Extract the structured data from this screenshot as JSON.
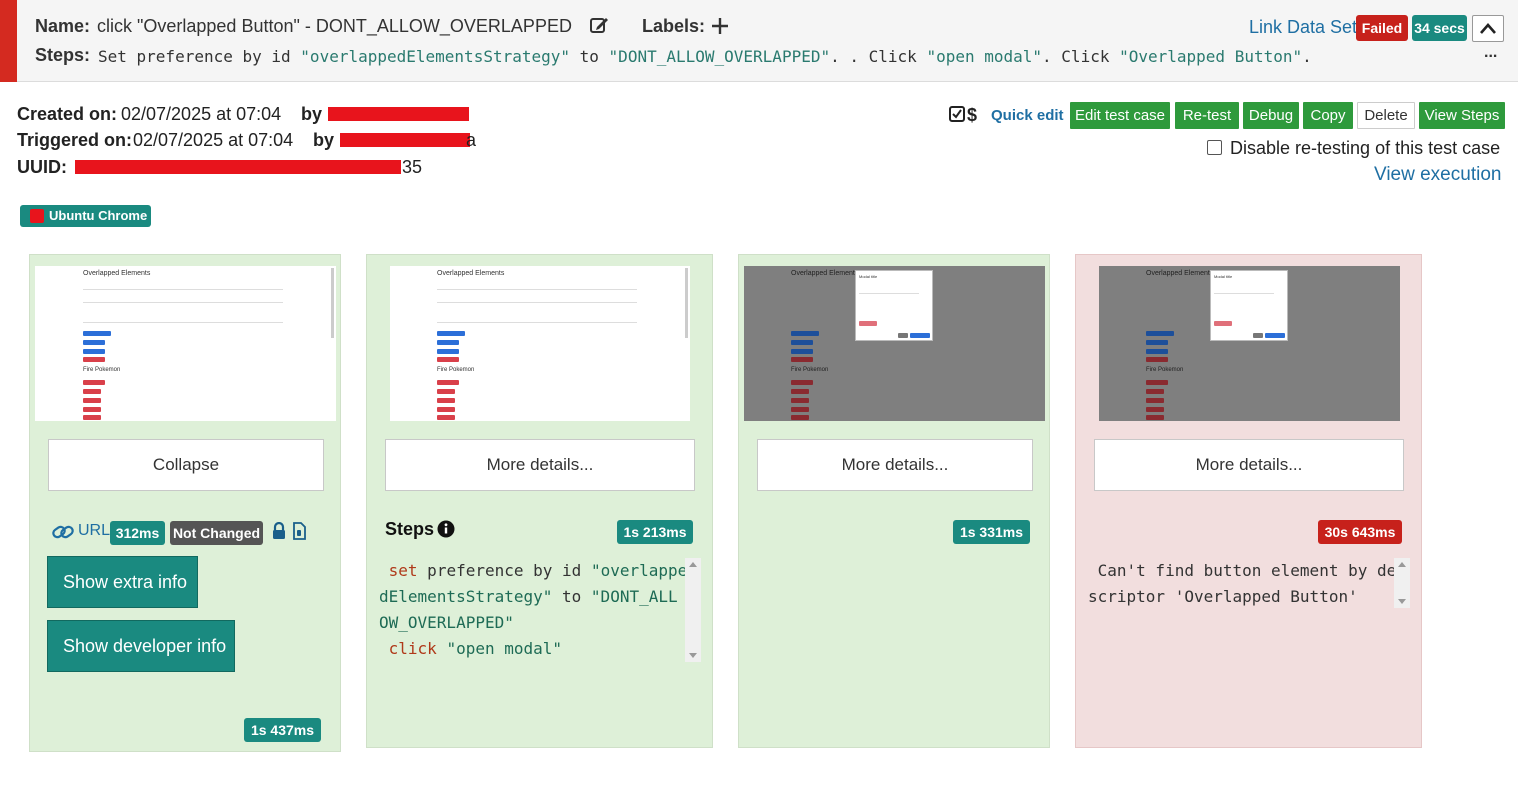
{
  "header": {
    "name_label": "Name:",
    "name_value": "click \"Overlapped Button\" - DONT_ALLOW_OVERLAPPED",
    "labels_label": "Labels:",
    "steps_label": "Steps:",
    "steps_parts": [
      "Set preference by id ",
      "\"overlappedElementsStrategy\"",
      " to ",
      "\"DONT_ALLOW_OVERLAPPED\"",
      ". . Click ",
      "\"open modal\"",
      ". Click ",
      "\"Overlapped Button\"",
      "."
    ],
    "link_data_set": "Link Data Set",
    "status": "Failed",
    "duration": "34 secs",
    "more": "..."
  },
  "info": {
    "created_label": "Created on:",
    "created_value": "02/07/2025 at 07:04",
    "by_label": "by",
    "triggered_label": "Triggered on:",
    "triggered_value": "02/07/2025 at 07:04",
    "triggered_by_tail": "a",
    "uuid_label": "UUID:",
    "uuid_tail": "35"
  },
  "actions": {
    "quick_edit": "Quick edit",
    "edit_test_case": "Edit test case",
    "retest": "Re-test",
    "debug": "Debug",
    "copy": "Copy",
    "delete": "Delete",
    "view_steps": "View Steps",
    "disable_retest": "Disable re-testing of this test case",
    "view_execution": "View execution"
  },
  "browser_badge": "Ubuntu Chrome",
  "colors": {
    "success_green": "#2e9a3c",
    "teal": "#1a8a80",
    "failed_red": "#c7211b",
    "card_ok_bg": "#def0d8",
    "card_fail_bg": "#f2dede"
  },
  "cards": [
    {
      "status": "passed",
      "button": "Collapse",
      "url_label": "URL",
      "url_time": "312ms",
      "change_badge": "Not Changed",
      "show_extra": "Show extra info",
      "show_dev": "Show developer info",
      "duration": "1s 437ms"
    },
    {
      "status": "passed",
      "button": "More details...",
      "steps_heading": "Steps",
      "duration": "1s 213ms",
      "code": {
        "l1_kw": "set",
        "l1_rest": " preference by id ",
        "l1_str": "\"overlappe",
        "l2_str": "dElementsStrategy\"",
        "l2_mid": " to ",
        "l2_str2": "\"DONT_ALL",
        "l3_str": "OW_OVERLAPPED\"",
        "l4_kw": "click",
        "l4_sp": " ",
        "l4_str": "\"open modal\""
      }
    },
    {
      "status": "passed",
      "button": "More details...",
      "duration": "1s 331ms"
    },
    {
      "status": "failed",
      "button": "More details...",
      "duration": "30s 643ms",
      "error_l1": " Can't find button element by de",
      "error_l2": "scriptor 'Overlapped Button'"
    }
  ],
  "mini": {
    "title": "Overlapped Elements",
    "section": "Fire Pokemon",
    "modal_title": "Modal title"
  }
}
